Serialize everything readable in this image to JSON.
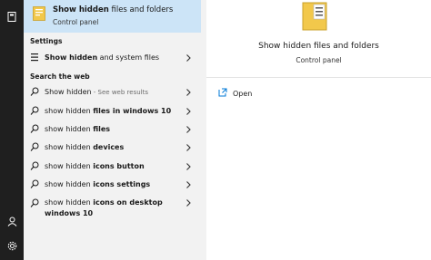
{
  "best_match": {
    "title_bold": "Show hidden",
    "title_rest": " files and folders",
    "subtitle": "Control panel",
    "icon": "folder-options-icon"
  },
  "sections": {
    "settings": "Settings",
    "web": "Search the web"
  },
  "settings_items": [
    {
      "bold": "Show hidden",
      "rest": " and system files",
      "icon": "settings-list-icon"
    }
  ],
  "web_items": [
    {
      "plain": "Show hidden",
      "bold": "",
      "muted": " - See web results"
    },
    {
      "plain": "show hidden ",
      "bold": "files in windows 10",
      "muted": ""
    },
    {
      "plain": "show hidden ",
      "bold": "files",
      "muted": ""
    },
    {
      "plain": "show hidden ",
      "bold": "devices",
      "muted": ""
    },
    {
      "plain": "show hidden ",
      "bold": "icons button",
      "muted": ""
    },
    {
      "plain": "show hidden ",
      "bold": "icons settings",
      "muted": ""
    },
    {
      "plain": "show hidden ",
      "bold": "icons on desktop windows 10",
      "muted": ""
    }
  ],
  "detail": {
    "title": "Show hidden files and folders",
    "subtitle": "Control panel",
    "actions": [
      {
        "label": "Open",
        "icon": "open-icon"
      }
    ]
  },
  "rail": {
    "icons": [
      "notebook-icon",
      "user-icon",
      "settings-gear-icon"
    ]
  },
  "colors": {
    "selected_bg": "#cce4f7",
    "rail_bg": "#1f1f1f",
    "accent": "#0078d7",
    "folder": "#f2c84b"
  }
}
